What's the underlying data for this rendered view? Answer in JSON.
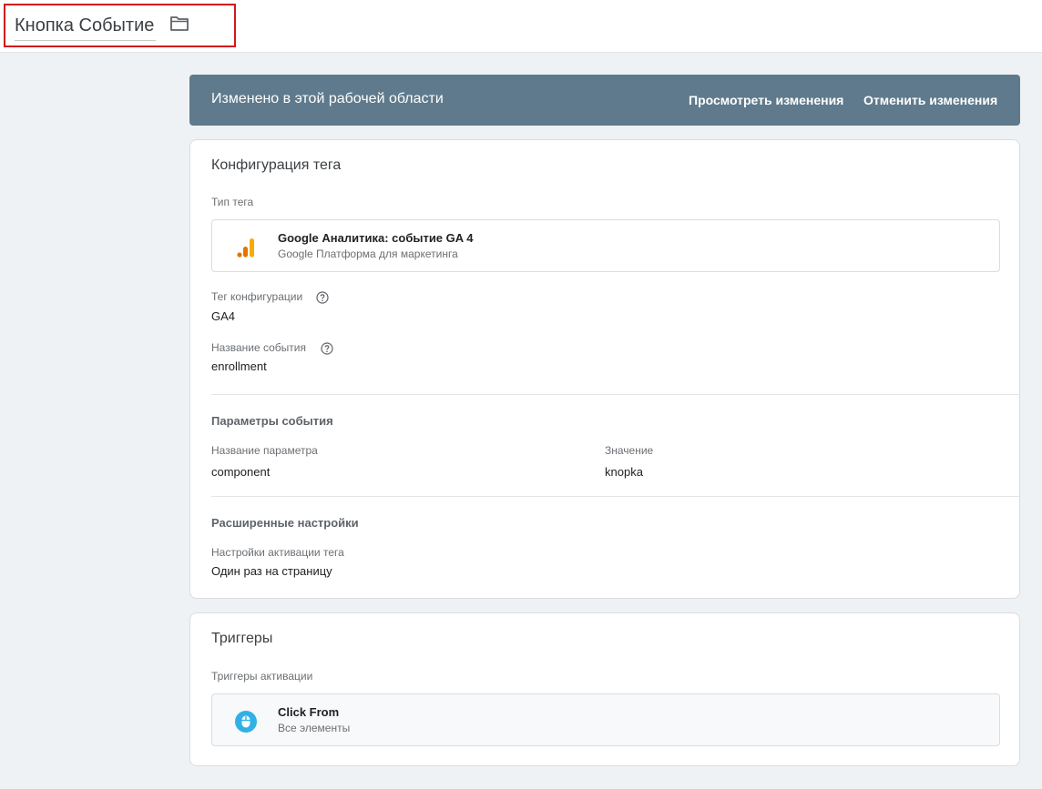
{
  "header": {
    "tag_name": "Кнопка Событие"
  },
  "banner": {
    "message": "Изменено в этой рабочей области",
    "view_changes": "Просмотреть изменения",
    "discard_changes": "Отменить изменения"
  },
  "tag_config": {
    "title": "Конфигурация тега",
    "tag_type_label": "Тип тега",
    "tag_type_name": "Google Аналитика: событие GA 4",
    "tag_type_sub": "Google Платформа для маркетинга",
    "config_tag_label": "Тег конфигурации",
    "config_tag_value": "GA4",
    "event_name_label": "Название события",
    "event_name_value": "enrollment",
    "event_params_title": "Параметры события",
    "param_name_header": "Название параметра",
    "param_value_header": "Значение",
    "params": [
      {
        "name": "component",
        "value": "knopka"
      }
    ],
    "advanced_title": "Расширенные настройки",
    "firing_label": "Настройки активации тега",
    "firing_value": "Один раз на страницу"
  },
  "triggers": {
    "title": "Триггеры",
    "firing_triggers_label": "Триггеры активации",
    "trigger_name": "Click From",
    "trigger_sub": "Все элементы"
  },
  "colors": {
    "banner": "#5f7a8c",
    "highlight_border": "#d0191e",
    "ga_orange": "#f9ab00",
    "ga_dark_orange": "#e37400",
    "click_blue": "#2fb1e6"
  }
}
